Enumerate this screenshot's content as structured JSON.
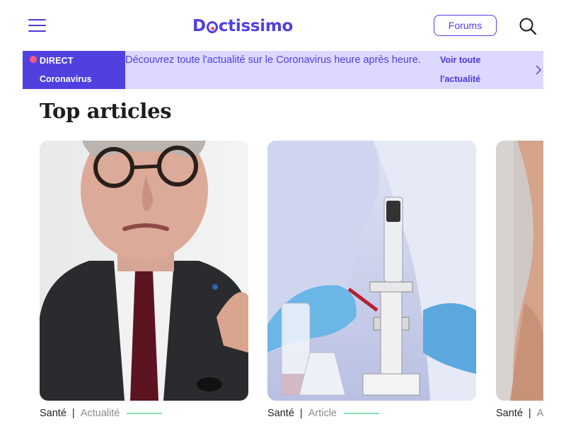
{
  "header": {
    "logo_text": "Doctissimo",
    "logo_before": "D",
    "logo_after": "ctissimo",
    "forums_label": "Forums",
    "menu_icon": "hamburger-menu-icon",
    "search_icon": "search-icon",
    "brand_color": "#5140e0"
  },
  "banner": {
    "badge_line1": "DIRECT",
    "badge_line2": "Coronavirus",
    "text": "Découvrez toute l'actualité sur le Coronavirus heure après heure.",
    "link_label": "Voir toute l'actualité",
    "live_dot_color": "#ff5a78",
    "background": "#dcd8ff"
  },
  "section": {
    "title": "Top articles"
  },
  "cards": [
    {
      "category": "Santé",
      "separator": "|",
      "type": "Actualité",
      "image": "man-with-glasses-photo"
    },
    {
      "category": "Santé",
      "separator": "|",
      "type": "Article",
      "image": "lab-microscope-photo"
    },
    {
      "category": "Santé",
      "separator": "|",
      "type": "Article",
      "image": "legs-photo"
    }
  ]
}
